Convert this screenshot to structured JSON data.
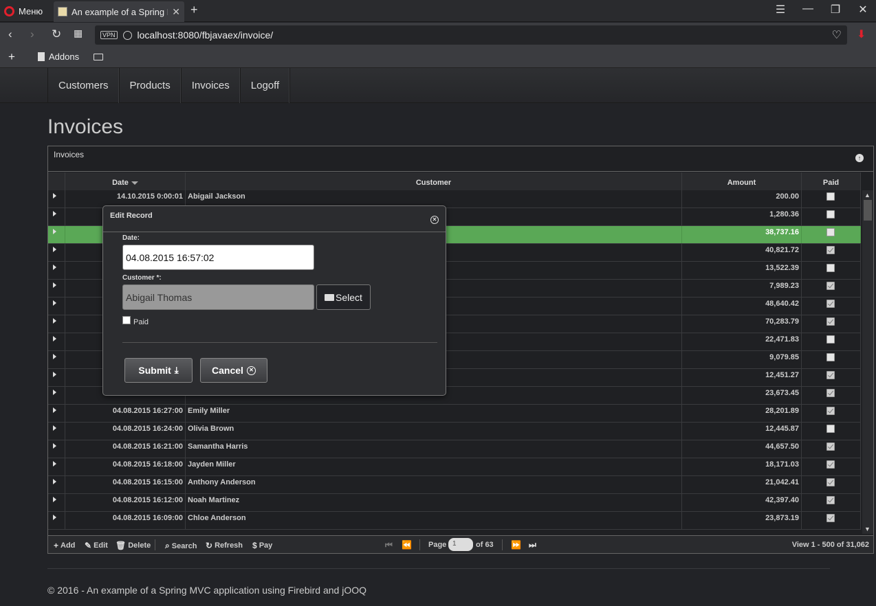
{
  "browser": {
    "menu_label": "Меню",
    "tab_title": "An example of a Spring M",
    "url": "localhost:8080/fbjavaex/invoice/",
    "vpn": "VPN",
    "bookmark_addons": "Addons"
  },
  "nav": {
    "items": [
      "Customers",
      "Products",
      "Invoices",
      "Logoff"
    ]
  },
  "page": {
    "title": "Invoices"
  },
  "grid": {
    "caption": "Invoices",
    "columns": {
      "date": "Date",
      "customer": "Customer",
      "amount": "Amount",
      "paid": "Paid"
    },
    "rows": [
      {
        "date": "14.10.2015 0:00:01",
        "customer": "Abigail Jackson",
        "amount": "200.00",
        "paid": false
      },
      {
        "date": "",
        "customer": "",
        "amount": "1,280.36",
        "paid": false
      },
      {
        "date": "",
        "customer": "",
        "amount": "38,737.16",
        "paid": false,
        "selected": true
      },
      {
        "date": "",
        "customer": "",
        "amount": "40,821.72",
        "paid": true
      },
      {
        "date": "",
        "customer": "",
        "amount": "13,522.39",
        "paid": false
      },
      {
        "date": "",
        "customer": "",
        "amount": "7,989.23",
        "paid": true
      },
      {
        "date": "",
        "customer": "",
        "amount": "48,640.42",
        "paid": true
      },
      {
        "date": "",
        "customer": "",
        "amount": "70,283.79",
        "paid": true
      },
      {
        "date": "",
        "customer": "",
        "amount": "22,471.83",
        "paid": false
      },
      {
        "date": "",
        "customer": "",
        "amount": "9,079.85",
        "paid": false
      },
      {
        "date": "",
        "customer": "",
        "amount": "12,451.27",
        "paid": true
      },
      {
        "date": "",
        "customer": "",
        "amount": "23,673.45",
        "paid": true
      },
      {
        "date": "04.08.2015 16:27:00",
        "customer": "Emily Miller",
        "amount": "28,201.89",
        "paid": true
      },
      {
        "date": "04.08.2015 16:24:00",
        "customer": "Olivia Brown",
        "amount": "12,445.87",
        "paid": false
      },
      {
        "date": "04.08.2015 16:21:00",
        "customer": "Samantha Harris",
        "amount": "44,657.50",
        "paid": true
      },
      {
        "date": "04.08.2015 16:18:00",
        "customer": "Jayden Miller",
        "amount": "18,171.03",
        "paid": true
      },
      {
        "date": "04.08.2015 16:15:00",
        "customer": "Anthony Anderson",
        "amount": "21,042.41",
        "paid": true
      },
      {
        "date": "04.08.2015 16:12:00",
        "customer": "Noah Martinez",
        "amount": "42,397.40",
        "paid": true
      },
      {
        "date": "04.08.2015 16:09:00",
        "customer": "Chloe Anderson",
        "amount": "23,873.19",
        "paid": true
      }
    ],
    "pager": {
      "add": "Add",
      "edit": "Edit",
      "delete": "Delete",
      "search": "Search",
      "refresh": "Refresh",
      "pay": "Pay",
      "page_label": "Page",
      "page_value": "1",
      "of_pages": "of 63",
      "view_info": "View 1 - 500 of 31,062"
    }
  },
  "modal": {
    "title": "Edit Record",
    "date_label": "Date:",
    "date_value": "04.08.2015 16:57:02",
    "customer_label": "Customer *:",
    "customer_value": "Abigail Thomas",
    "select_label": "Select",
    "paid_label": "Paid",
    "submit_label": "Submit",
    "cancel_label": "Cancel"
  },
  "footer": {
    "text": "© 2016 - An example of a Spring MVC application using Firebird and jOOQ"
  },
  "colors": {
    "selected_row": "#5aa856",
    "background": "#222327"
  }
}
